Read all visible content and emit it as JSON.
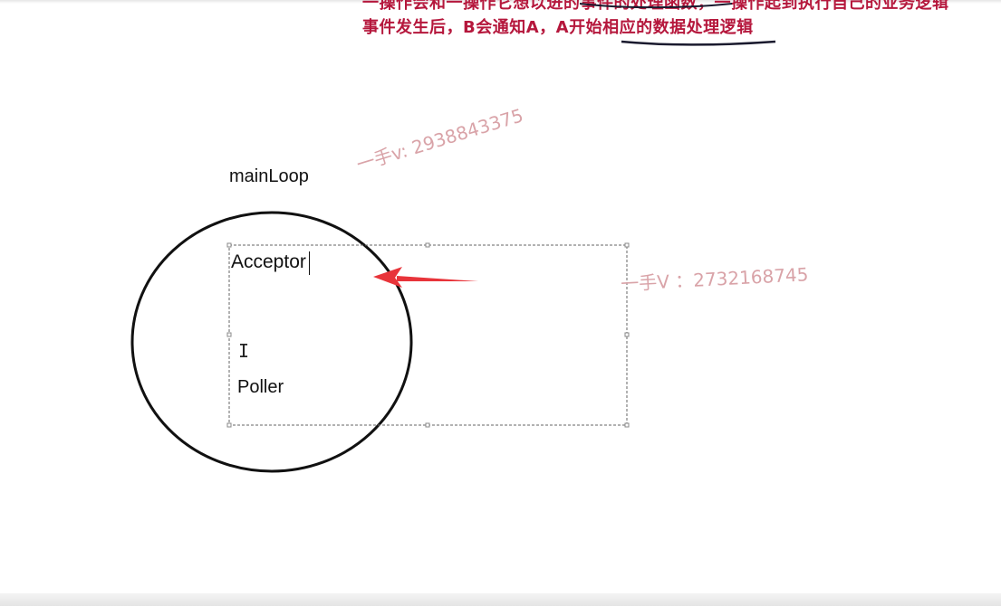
{
  "heading": {
    "partial_line": "一操作会和一操作它想以进的事件的处理函数，一操作起到执行自己的业务逻辑",
    "line": "事件发生后，B会通知A，A开始相应的数据处理逻辑",
    "color": "#b5173c"
  },
  "diagram": {
    "mainloop_label": "mainLoop",
    "acceptor_label": "Acceptor",
    "poller_label": "Poller",
    "arrow_color": "#e8343a"
  },
  "watermarks": {
    "first": "一手v: 2938843375",
    "second": "一手V ：2732168745",
    "color": "#d9a3a8"
  },
  "cursor": {
    "ibeam_glyph": "I"
  }
}
